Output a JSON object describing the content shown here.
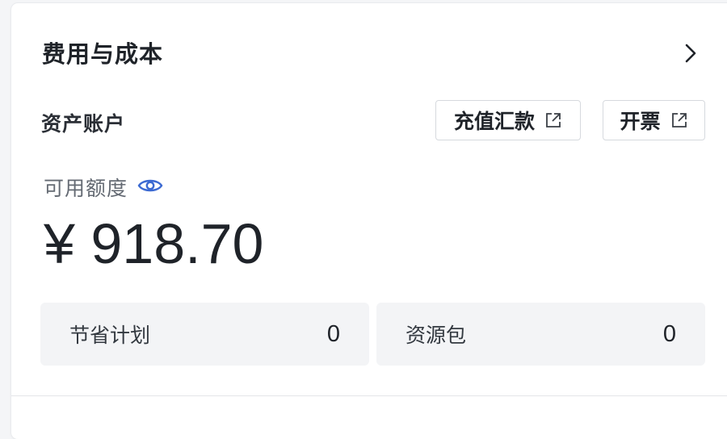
{
  "card": {
    "title": "费用与成本",
    "chevron_icon": "chevron-right-icon"
  },
  "account": {
    "section_label": "资产账户",
    "recharge_button": "充值汇款",
    "invoice_button": "开票",
    "button_icon": "external-link-icon"
  },
  "quota": {
    "label": "可用额度",
    "visibility_icon": "eye-icon",
    "amount": "¥ 918.70",
    "eye_color": "#3c6ad2"
  },
  "stats": [
    {
      "label": "节省计划",
      "value": "0"
    },
    {
      "label": "资源包",
      "value": "0"
    }
  ]
}
